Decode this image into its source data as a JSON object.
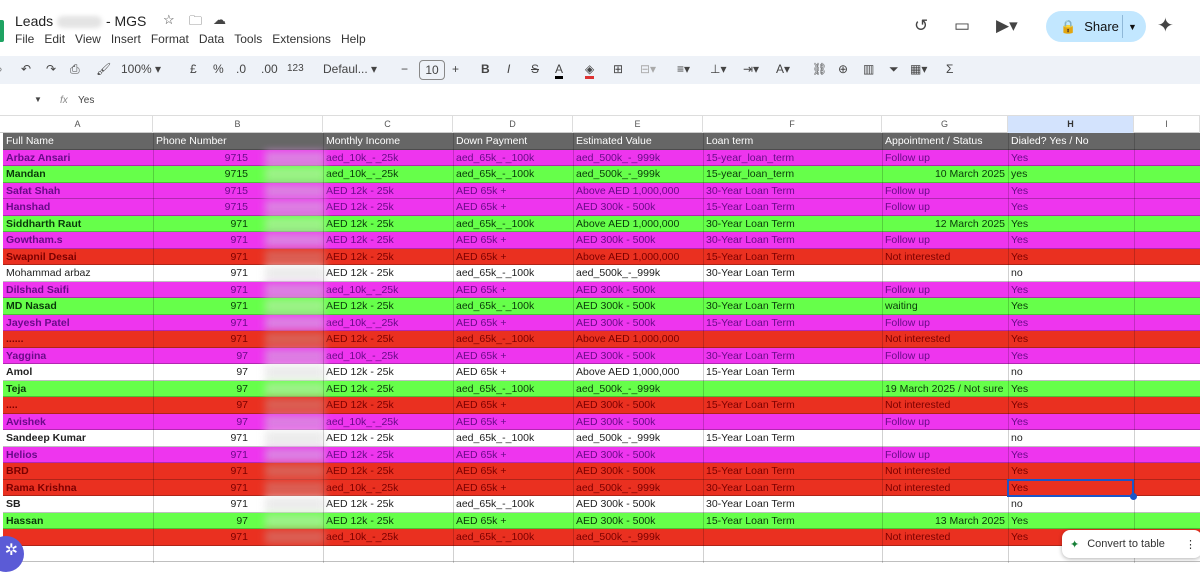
{
  "doc": {
    "title_prefix": "Leads",
    "title_suffix": "- MGS"
  },
  "menu": [
    "File",
    "Edit",
    "View",
    "Insert",
    "Format",
    "Data",
    "Tools",
    "Extensions",
    "Help"
  ],
  "share_label": "Share",
  "toolbar": {
    "zoom": "100%",
    "currency": "£",
    "percent": "%",
    "dec_decrease": ".0",
    "dec_increase": ".00",
    "number_format": "123",
    "font": "Defaul...",
    "font_size": "10",
    "bold": "B",
    "italic": "I",
    "text_color": "A"
  },
  "formula_bar": {
    "fx": "fx",
    "value": "Yes"
  },
  "columns": [
    "A",
    "B",
    "C",
    "D",
    "E",
    "F",
    "G",
    "H",
    "I"
  ],
  "headers": [
    "Full Name",
    "Phone Number",
    "Monthly Income",
    "Down Payment",
    "Estimated Value",
    "Loan term",
    "Appointment / Status",
    "Dialed?  Yes / No"
  ],
  "colors": {
    "magenta": "#ee35ee",
    "green": "#66ff4a",
    "red": "#ea3020",
    "white": "#ffffff",
    "header": "#666666"
  },
  "rows": [
    {
      "name": "Arbaz Ansari",
      "phone": "9715",
      "income": "aed_10k_-_25k",
      "down": "aed_65k_-_100k",
      "value": "aed_500k_-_999k",
      "term": "15-year_loan_term",
      "status": "Follow up",
      "dialed": "Yes",
      "color": "magenta"
    },
    {
      "name": "Mandan",
      "phone": "9715",
      "income": "aed_10k_-_25k",
      "down": "aed_65k_-_100k",
      "value": "aed_500k_-_999k",
      "term": "15-year_loan_term",
      "status": "10 March 2025",
      "dialed": "yes",
      "color": "green"
    },
    {
      "name": "Safat Shah",
      "phone": "9715",
      "income": "AED 12k - 25k",
      "down": "AED 65k +",
      "value": "Above AED 1,000,000",
      "term": "30-Year Loan Term",
      "status": "Follow up",
      "dialed": "Yes",
      "color": "magenta"
    },
    {
      "name": "Hanshad",
      "phone": "9715",
      "income": "AED 12k - 25k",
      "down": "AED 65k +",
      "value": "AED 300k - 500k",
      "term": "15-Year Loan Term",
      "status": "Follow up",
      "dialed": "Yes",
      "color": "magenta"
    },
    {
      "name": "Siddharth Raut",
      "phone": "971",
      "income": "AED 12k - 25k",
      "down": "aed_65k_-_100k",
      "value": "Above AED 1,000,000",
      "term": "30-Year Loan Term",
      "status": "12 March 2025",
      "dialed": "Yes",
      "color": "green"
    },
    {
      "name": "Gowtham.s",
      "phone": "971",
      "income": "AED 12k - 25k",
      "down": "AED 65k +",
      "value": "AED 300k - 500k",
      "term": "30-Year Loan Term",
      "status": "Follow up",
      "dialed": "Yes",
      "color": "magenta"
    },
    {
      "name": "Swapnil Desai",
      "phone": "971",
      "income": "AED 12k - 25k",
      "down": "AED 65k +",
      "value": "Above AED 1,000,000",
      "term": "15-Year Loan Term",
      "status": "Not interested",
      "dialed": "Yes",
      "color": "red"
    },
    {
      "name": "Mohammad arbaz",
      "phone": "971",
      "income": "AED 12k - 25k",
      "down": "aed_65k_-_100k",
      "value": "aed_500k_-_999k",
      "term": "30-Year Loan Term",
      "status": "",
      "dialed": "no",
      "color": "white",
      "plain": true
    },
    {
      "name": "Dilshad Saifi",
      "phone": "971",
      "income": "aed_10k_-_25k",
      "down": "AED 65k +",
      "value": "AED 300k - 500k",
      "term": "",
      "status": "Follow up",
      "dialed": "Yes",
      "color": "magenta"
    },
    {
      "name": "MD Nasad",
      "phone": "971",
      "income": "AED 12k - 25k",
      "down": "aed_65k_-_100k",
      "value": "AED 300k - 500k",
      "term": "30-Year Loan Term",
      "status": "waiting",
      "dialed": "Yes",
      "color": "green"
    },
    {
      "name": "Jayesh Patel",
      "phone": "971",
      "income": "aed_10k_-_25k",
      "down": "AED 65k +",
      "value": "AED 300k - 500k",
      "term": "15-Year Loan Term",
      "status": "Follow up",
      "dialed": "Yes",
      "color": "magenta"
    },
    {
      "name": "......",
      "phone": "971",
      "income": "AED 12k - 25k",
      "down": "aed_65k_-_100k",
      "value": "Above AED 1,000,000",
      "term": "",
      "status": "Not interested",
      "dialed": "Yes",
      "color": "red"
    },
    {
      "name": "Yaggina",
      "phone": "97",
      "income": "aed_10k_-_25k",
      "down": "AED 65k +",
      "value": "AED 300k - 500k",
      "term": "30-Year Loan Term",
      "status": "Follow up",
      "dialed": "Yes",
      "color": "magenta"
    },
    {
      "name": "Amol",
      "phone": "97",
      "income": "AED 12k - 25k",
      "down": "AED 65k +",
      "value": "Above AED 1,000,000",
      "term": "15-Year Loan Term",
      "status": "",
      "dialed": "no",
      "color": "white"
    },
    {
      "name": "Teja",
      "phone": "97",
      "income": "AED 12k - 25k",
      "down": "aed_65k_-_100k",
      "value": "aed_500k_-_999k",
      "term": "",
      "status": "19 March 2025 / Not sure",
      "dialed": "Yes",
      "color": "green"
    },
    {
      "name": "....",
      "phone": "97",
      "income": "AED 12k - 25k",
      "down": "AED 65k +",
      "value": "AED 300k - 500k",
      "term": "15-Year Loan Term",
      "status": "Not interested",
      "dialed": "Yes",
      "color": "red"
    },
    {
      "name": "Avishek",
      "phone": "97",
      "income": "aed_10k_-_25k",
      "down": "AED 65k +",
      "value": "AED 300k - 500k",
      "term": "",
      "status": "Follow up",
      "dialed": "Yes",
      "color": "magenta"
    },
    {
      "name": "Sandeep Kumar",
      "phone": "971",
      "income": "AED 12k - 25k",
      "down": "aed_65k_-_100k",
      "value": "aed_500k_-_999k",
      "term": "15-Year Loan Term",
      "status": "",
      "dialed": "no",
      "color": "white"
    },
    {
      "name": "Helios",
      "phone": "971",
      "income": "AED 12k - 25k",
      "down": "AED 65k +",
      "value": "AED 300k - 500k",
      "term": "",
      "status": "Follow up",
      "dialed": "Yes",
      "color": "magenta"
    },
    {
      "name": "BRD",
      "phone": "971",
      "income": "AED 12k - 25k",
      "down": "AED 65k +",
      "value": "AED 300k - 500k",
      "term": "15-Year Loan Term",
      "status": "Not interested",
      "dialed": "Yes",
      "color": "red"
    },
    {
      "name": "Rama Krishna",
      "phone": "971",
      "income": "aed_10k_-_25k",
      "down": "AED 65k +",
      "value": "aed_500k_-_999k",
      "term": "30-Year Loan Term",
      "status": "Not interested",
      "dialed": "Yes",
      "color": "red"
    },
    {
      "name": "SB",
      "phone": "971",
      "income": "AED 12k - 25k",
      "down": "aed_65k_-_100k",
      "value": "AED 300k - 500k",
      "term": "30-Year Loan Term",
      "status": "",
      "dialed": "no",
      "color": "white"
    },
    {
      "name": "Hassan",
      "phone": "97",
      "income": "AED 12k - 25k",
      "down": "AED 65k +",
      "value": "AED 300k - 500k",
      "term": "15-Year Loan Term",
      "status": "13 March 2025",
      "dialed": "Yes",
      "color": "green"
    },
    {
      "name": "",
      "phone": "971",
      "income": "aed_10k_-_25k",
      "down": "aed_65k_-_100k",
      "value": "aed_500k_-_999k",
      "term": "",
      "status": "Not interested",
      "dialed": "Yes",
      "color": "red"
    }
  ],
  "convert_label": "Convert to table"
}
